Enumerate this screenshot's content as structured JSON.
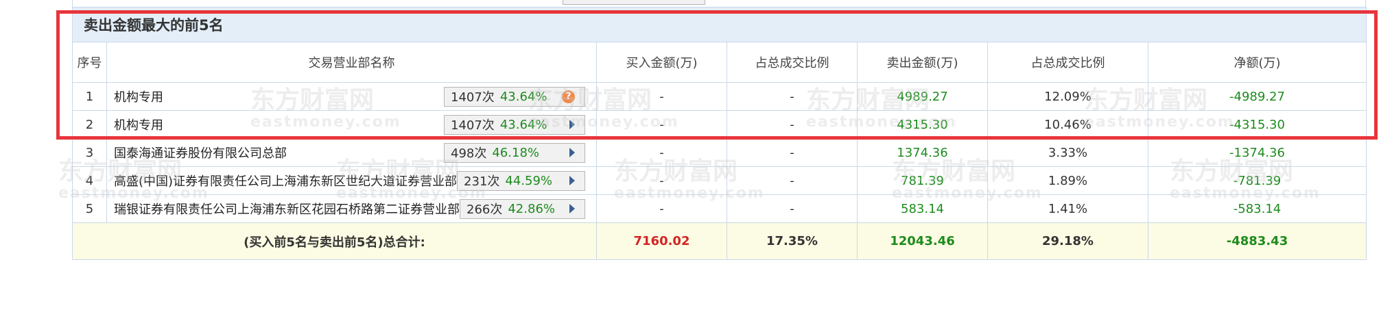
{
  "section_title": "卖出金额最大的前5名",
  "headers": [
    "序号",
    "交易营业部名称",
    "买入金额(万)",
    "占总成交比例",
    "卖出金额(万)",
    "占总成交比例",
    "净额(万)"
  ],
  "rows": [
    {
      "idx": "1",
      "name": "机构专用",
      "count": "1407次",
      "pct": "43.64%",
      "action": "help-icon",
      "buy": "-",
      "buy_ratio": "-",
      "sell": "4989.27",
      "sell_ratio": "12.09%",
      "net": "-4989.27"
    },
    {
      "idx": "2",
      "name": "机构专用",
      "count": "1407次",
      "pct": "43.64%",
      "action": "arrow-right-icon",
      "buy": "-",
      "buy_ratio": "-",
      "sell": "4315.30",
      "sell_ratio": "10.46%",
      "net": "-4315.30"
    },
    {
      "idx": "3",
      "name": "国泰海通证券股份有限公司总部",
      "count": "498次",
      "pct": "46.18%",
      "action": "arrow-right-icon",
      "buy": "-",
      "buy_ratio": "-",
      "sell": "1374.36",
      "sell_ratio": "3.33%",
      "net": "-1374.36"
    },
    {
      "idx": "4",
      "name": "高盛(中国)证券有限责任公司上海浦东新区世纪大道证券营业部",
      "count": "231次",
      "pct": "44.59%",
      "action": "arrow-right-icon",
      "buy": "-",
      "buy_ratio": "-",
      "sell": "781.39",
      "sell_ratio": "1.89%",
      "net": "-781.39"
    },
    {
      "idx": "5",
      "name": "瑞银证券有限责任公司上海浦东新区花园石桥路第二证券营业部",
      "count": "266次",
      "pct": "42.86%",
      "action": "arrow-right-icon",
      "buy": "-",
      "buy_ratio": "-",
      "sell": "583.14",
      "sell_ratio": "1.41%",
      "net": "-583.14"
    }
  ],
  "total": {
    "label": "(买入前5名与卖出前5名)总合计:",
    "buy": "7160.02",
    "buy_ratio": "17.35%",
    "sell": "12043.46",
    "sell_ratio": "29.18%",
    "net": "-4883.43"
  },
  "help_glyph": "?",
  "watermark": {
    "brand": "东方财富网",
    "domain": "eastmoney.com"
  },
  "colors": {
    "highlight": "#e8353c",
    "positive_text": "#1d8b1d",
    "buy_total": "#d42424",
    "title_bg": "#e3eef9",
    "total_bg": "#fcfbe3"
  }
}
